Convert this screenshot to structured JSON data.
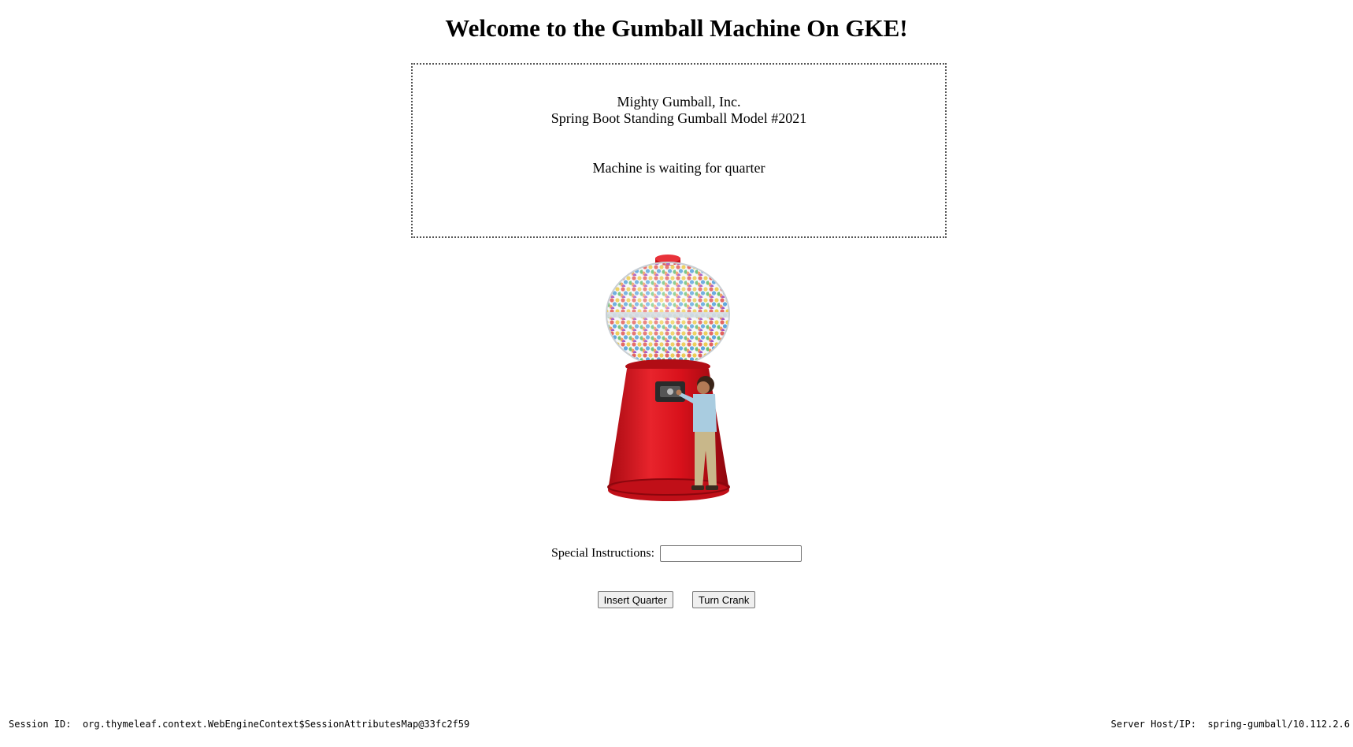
{
  "page": {
    "title": "Welcome to the Gumball Machine On GKE!"
  },
  "message": {
    "company": "Mighty Gumball, Inc.",
    "model": "Spring Boot Standing Gumball Model #2021",
    "status": "Machine is waiting for quarter"
  },
  "machine_image": {
    "icon": "gumball-machine-image",
    "colors": {
      "body": "#d8111b",
      "globe_glass": "#e8eef2",
      "cap": "#c9121a"
    }
  },
  "form": {
    "instructions_label": "Special Instructions:",
    "instructions_value": "",
    "instructions_placeholder": "",
    "insert_quarter_label": "Insert Quarter",
    "turn_crank_label": "Turn Crank"
  },
  "footer": {
    "session_label": "Session ID:",
    "session_value": "org.thymeleaf.context.WebEngineContext$SessionAttributesMap@33fc2f59",
    "server_label": "Server Host/IP:",
    "server_value": "spring-gumball/10.112.2.6"
  }
}
